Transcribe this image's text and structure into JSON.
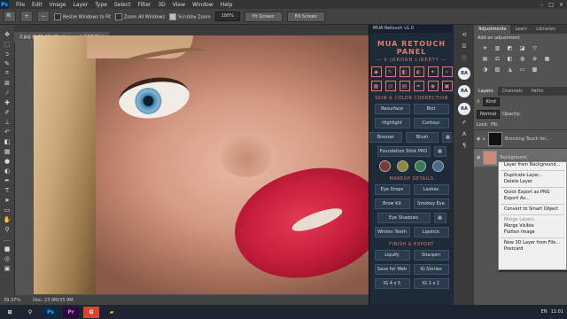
{
  "app": {
    "logo": "Ps"
  },
  "menu": [
    "File",
    "Edit",
    "Image",
    "Layer",
    "Type",
    "Select",
    "Filter",
    "3D",
    "View",
    "Window",
    "Help"
  ],
  "window_controls": [
    "–",
    "□",
    "×"
  ],
  "options_bar": {
    "resize_windows": "Resize Windows to Fit",
    "zoom_all": "Zoom All Windows",
    "scrubby_zoom": "Scrubby Zoom",
    "zoom_value": "100%",
    "fit_screen": "Fit Screen",
    "fill_screen": "Fill Screen"
  },
  "document": {
    "tab_label": "2.jpg @ 39.4% (Background, RGB/8) *"
  },
  "status": {
    "zoom": "39.37%",
    "doc": "Doc: 23.9M/35.9M"
  },
  "retouch_panel": {
    "title": "MUA Retouch v1.0",
    "brand": "MUA RETOUCH PANEL",
    "brand_sub": "— X JORDAN LIBERTY —",
    "skin_section": "SKIN & COLOR CORRECTION",
    "skin_buttons": [
      "Resurface",
      "Blot",
      "Highlight",
      "Contour",
      "Bronzer",
      "Blush",
      "Foundation Stick PRO"
    ],
    "makeup_section": "MAKEUP DETAILS",
    "makeup_buttons": [
      "Eye Drops",
      "Lashes",
      "Brow Kit",
      "Smokey Eye",
      "Eye Shadows",
      "Whiten Teeth",
      "Lipstick"
    ],
    "finish_section": "FINISH & EXPORT",
    "finish_buttons": [
      "Liquify",
      "Sharpen",
      "Save for Web",
      "IG Stories",
      "IG 4 x 5",
      "IG 1 x 1"
    ],
    "swatch_colors": [
      "#7a3a3a",
      "#8a8a3a",
      "#3a7a5a",
      "#4a6a8a"
    ]
  },
  "dock": {
    "ra_label": "RA"
  },
  "right_panel": {
    "tabs": [
      "Adjustments",
      "Learn",
      "Libraries"
    ],
    "add_adjustment": "Add an adjustment",
    "layer_tabs": [
      "Layers",
      "Channels",
      "Paths"
    ],
    "kind": "Kind",
    "blend_mode": "Normal",
    "opacity": "Opacity:",
    "lock": "Lock:",
    "fill": "Fill:",
    "layers": [
      {
        "name": "Bronzing Touch for..."
      },
      {
        "name": "Background"
      }
    ]
  },
  "context_menu": {
    "items": [
      {
        "label": "Layer from Background...",
        "disabled": false
      },
      {
        "label": "Duplicate Layer...",
        "disabled": false,
        "sep_before": true
      },
      {
        "label": "Delete Layer",
        "disabled": false
      },
      {
        "label": "Quick Export as PNG",
        "disabled": false,
        "sep_before": true
      },
      {
        "label": "Export As...",
        "disabled": false
      },
      {
        "label": "Convert to Smart Object",
        "disabled": false,
        "sep_before": true
      },
      {
        "label": "Merge Layers",
        "disabled": true,
        "sep_before": true
      },
      {
        "label": "Merge Visible",
        "disabled": false
      },
      {
        "label": "Flatten Image",
        "disabled": false
      },
      {
        "label": "New 3D Layer from File...",
        "disabled": false,
        "sep_before": true
      },
      {
        "label": "Postcard",
        "disabled": false
      }
    ]
  },
  "taskbar": {
    "apps": [
      {
        "label": "Ps",
        "color": "#31a8ff",
        "bg": "#0a2a4a"
      },
      {
        "label": "Pr",
        "color": "#e77cff",
        "bg": "#2a0a3a"
      },
      {
        "label": "G",
        "color": "#ffffff",
        "bg": "#d64531"
      }
    ],
    "language": "EN",
    "time": "11:01"
  }
}
